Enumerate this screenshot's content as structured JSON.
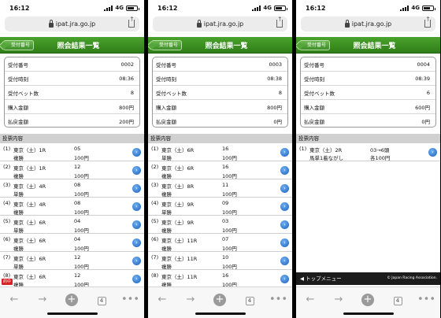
{
  "panels": [
    {
      "status": {
        "time": "16:12",
        "network": "4G"
      },
      "url": "ipat.jra.go.jp",
      "header": {
        "back": "受付番号",
        "title": "照会結果一覧"
      },
      "summary": [
        {
          "label": "受付番号",
          "value": "0002"
        },
        {
          "label": "受付時刻",
          "value": "08:36"
        },
        {
          "label": "受付ベット数",
          "value": "8"
        },
        {
          "label": "購入金額",
          "value": "800円"
        },
        {
          "label": "払戻金額",
          "value": "200円"
        }
      ],
      "items_heading": "投票内容",
      "items": [
        {
          "no": "(1)",
          "race": "東京（土）1R",
          "type": "複勝",
          "combo": "05",
          "amount": "100円"
        },
        {
          "no": "(2)",
          "race": "東京（土）1R",
          "type": "複勝",
          "combo": "12",
          "amount": "100円"
        },
        {
          "no": "(3)",
          "race": "東京（土）4R",
          "type": "単勝",
          "combo": "08",
          "amount": "100円"
        },
        {
          "no": "(4)",
          "race": "東京（土）4R",
          "type": "複勝",
          "combo": "08",
          "amount": "100円"
        },
        {
          "no": "(5)",
          "race": "東京（土）6R",
          "type": "単勝",
          "combo": "04",
          "amount": "100円"
        },
        {
          "no": "(6)",
          "race": "東京（土）6R",
          "type": "複勝",
          "combo": "04",
          "amount": "100円"
        },
        {
          "no": "(7)",
          "race": "東京（土）6R",
          "type": "単勝",
          "combo": "12",
          "amount": "100円"
        },
        {
          "no": "(8)",
          "race": "東京（土）6R",
          "type": "複勝",
          "combo": "12",
          "amount": "100円",
          "badge": "的中"
        }
      ],
      "tabs_count": "4"
    },
    {
      "status": {
        "time": "16:12",
        "network": "4G"
      },
      "url": "ipat.jra.go.jp",
      "header": {
        "back": "受付番号",
        "title": "照会結果一覧"
      },
      "summary": [
        {
          "label": "受付番号",
          "value": "0003"
        },
        {
          "label": "受付時刻",
          "value": "08:38"
        },
        {
          "label": "受付ベット数",
          "value": "8"
        },
        {
          "label": "購入金額",
          "value": "800円"
        },
        {
          "label": "払戻金額",
          "value": "0円"
        }
      ],
      "items_heading": "投票内容",
      "items": [
        {
          "no": "(1)",
          "race": "東京（土）6R",
          "type": "単勝",
          "combo": "16",
          "amount": "100円"
        },
        {
          "no": "(2)",
          "race": "東京（土）6R",
          "type": "複勝",
          "combo": "16",
          "amount": "100円"
        },
        {
          "no": "(3)",
          "race": "東京（土）8R",
          "type": "複勝",
          "combo": "11",
          "amount": "100円"
        },
        {
          "no": "(4)",
          "race": "東京（土）9R",
          "type": "単勝",
          "combo": "09",
          "amount": "100円"
        },
        {
          "no": "(5)",
          "race": "東京（土）9R",
          "type": "複勝",
          "combo": "03",
          "amount": "100円"
        },
        {
          "no": "(6)",
          "race": "東京（土）11R",
          "type": "複勝",
          "combo": "07",
          "amount": "100円"
        },
        {
          "no": "(7)",
          "race": "東京（土）11R",
          "type": "複勝",
          "combo": "10",
          "amount": "100円"
        },
        {
          "no": "(8)",
          "race": "東京（土）11R",
          "type": "複勝",
          "combo": "16",
          "amount": "100円"
        }
      ],
      "tabs_count": "4"
    },
    {
      "status": {
        "time": "16:12",
        "network": "4G"
      },
      "url": "ipat.jra.go.jp",
      "header": {
        "back": "受付番号",
        "title": "照会結果一覧"
      },
      "summary": [
        {
          "label": "受付番号",
          "value": "0004"
        },
        {
          "label": "受付時刻",
          "value": "08:39"
        },
        {
          "label": "受付ベット数",
          "value": "6"
        },
        {
          "label": "購入金額",
          "value": "600円"
        },
        {
          "label": "払戻金額",
          "value": "0円"
        }
      ],
      "items_heading": "投票内容",
      "items": [
        {
          "no": "(1)",
          "race": "東京（土）2R",
          "type": "馬単1着ながし",
          "combo": "03→6頭",
          "amount": "各100円"
        }
      ],
      "footer": {
        "menu": "◀ トップメニュー",
        "copyright": "© Japan Racing Association."
      },
      "tabs_count": "4"
    }
  ],
  "colors": {
    "header_green": "#3a8f22",
    "arrow_blue": "#1b5fbf",
    "hit_badge": "#d42020"
  }
}
